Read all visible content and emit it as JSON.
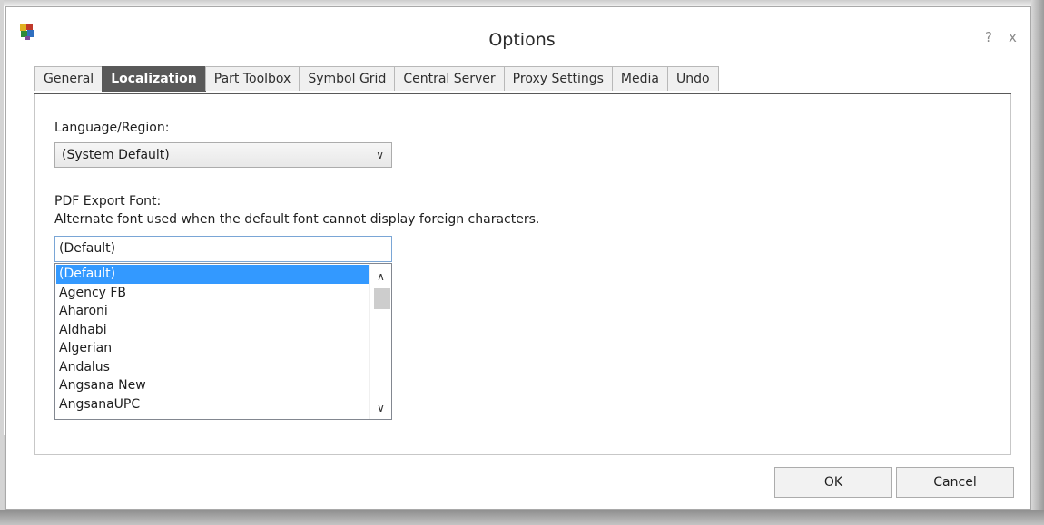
{
  "window": {
    "title": "Options",
    "help_label": "?",
    "close_label": "x"
  },
  "tabs": [
    {
      "label": "General",
      "active": false
    },
    {
      "label": "Localization",
      "active": true
    },
    {
      "label": "Part Toolbox",
      "active": false
    },
    {
      "label": "Symbol Grid",
      "active": false
    },
    {
      "label": "Central Server",
      "active": false
    },
    {
      "label": "Proxy Settings",
      "active": false
    },
    {
      "label": "Media",
      "active": false
    },
    {
      "label": "Undo",
      "active": false
    }
  ],
  "localization": {
    "language_label": "Language/Region:",
    "language_value": "(System Default)",
    "pdf_font_label": "PDF Export Font:",
    "pdf_font_description": "Alternate font used when the default font cannot display foreign characters.",
    "pdf_font_value": "(Default)",
    "font_list": [
      "(Default)",
      "Agency FB",
      "Aharoni",
      "Aldhabi",
      "Algerian",
      "Andalus",
      "Angsana New",
      "AngsanaUPC"
    ],
    "selected_index": 0
  },
  "buttons": {
    "ok": "OK",
    "cancel": "Cancel"
  },
  "icons": {
    "app": "app-puzzle-icon",
    "dropdown": "chevron-down-icon",
    "scroll_up": "chevron-up-icon",
    "scroll_down": "chevron-down-icon"
  },
  "colors": {
    "active_tab": "#595959",
    "selection": "#3399ff",
    "focus_border": "#7aa6d6"
  }
}
